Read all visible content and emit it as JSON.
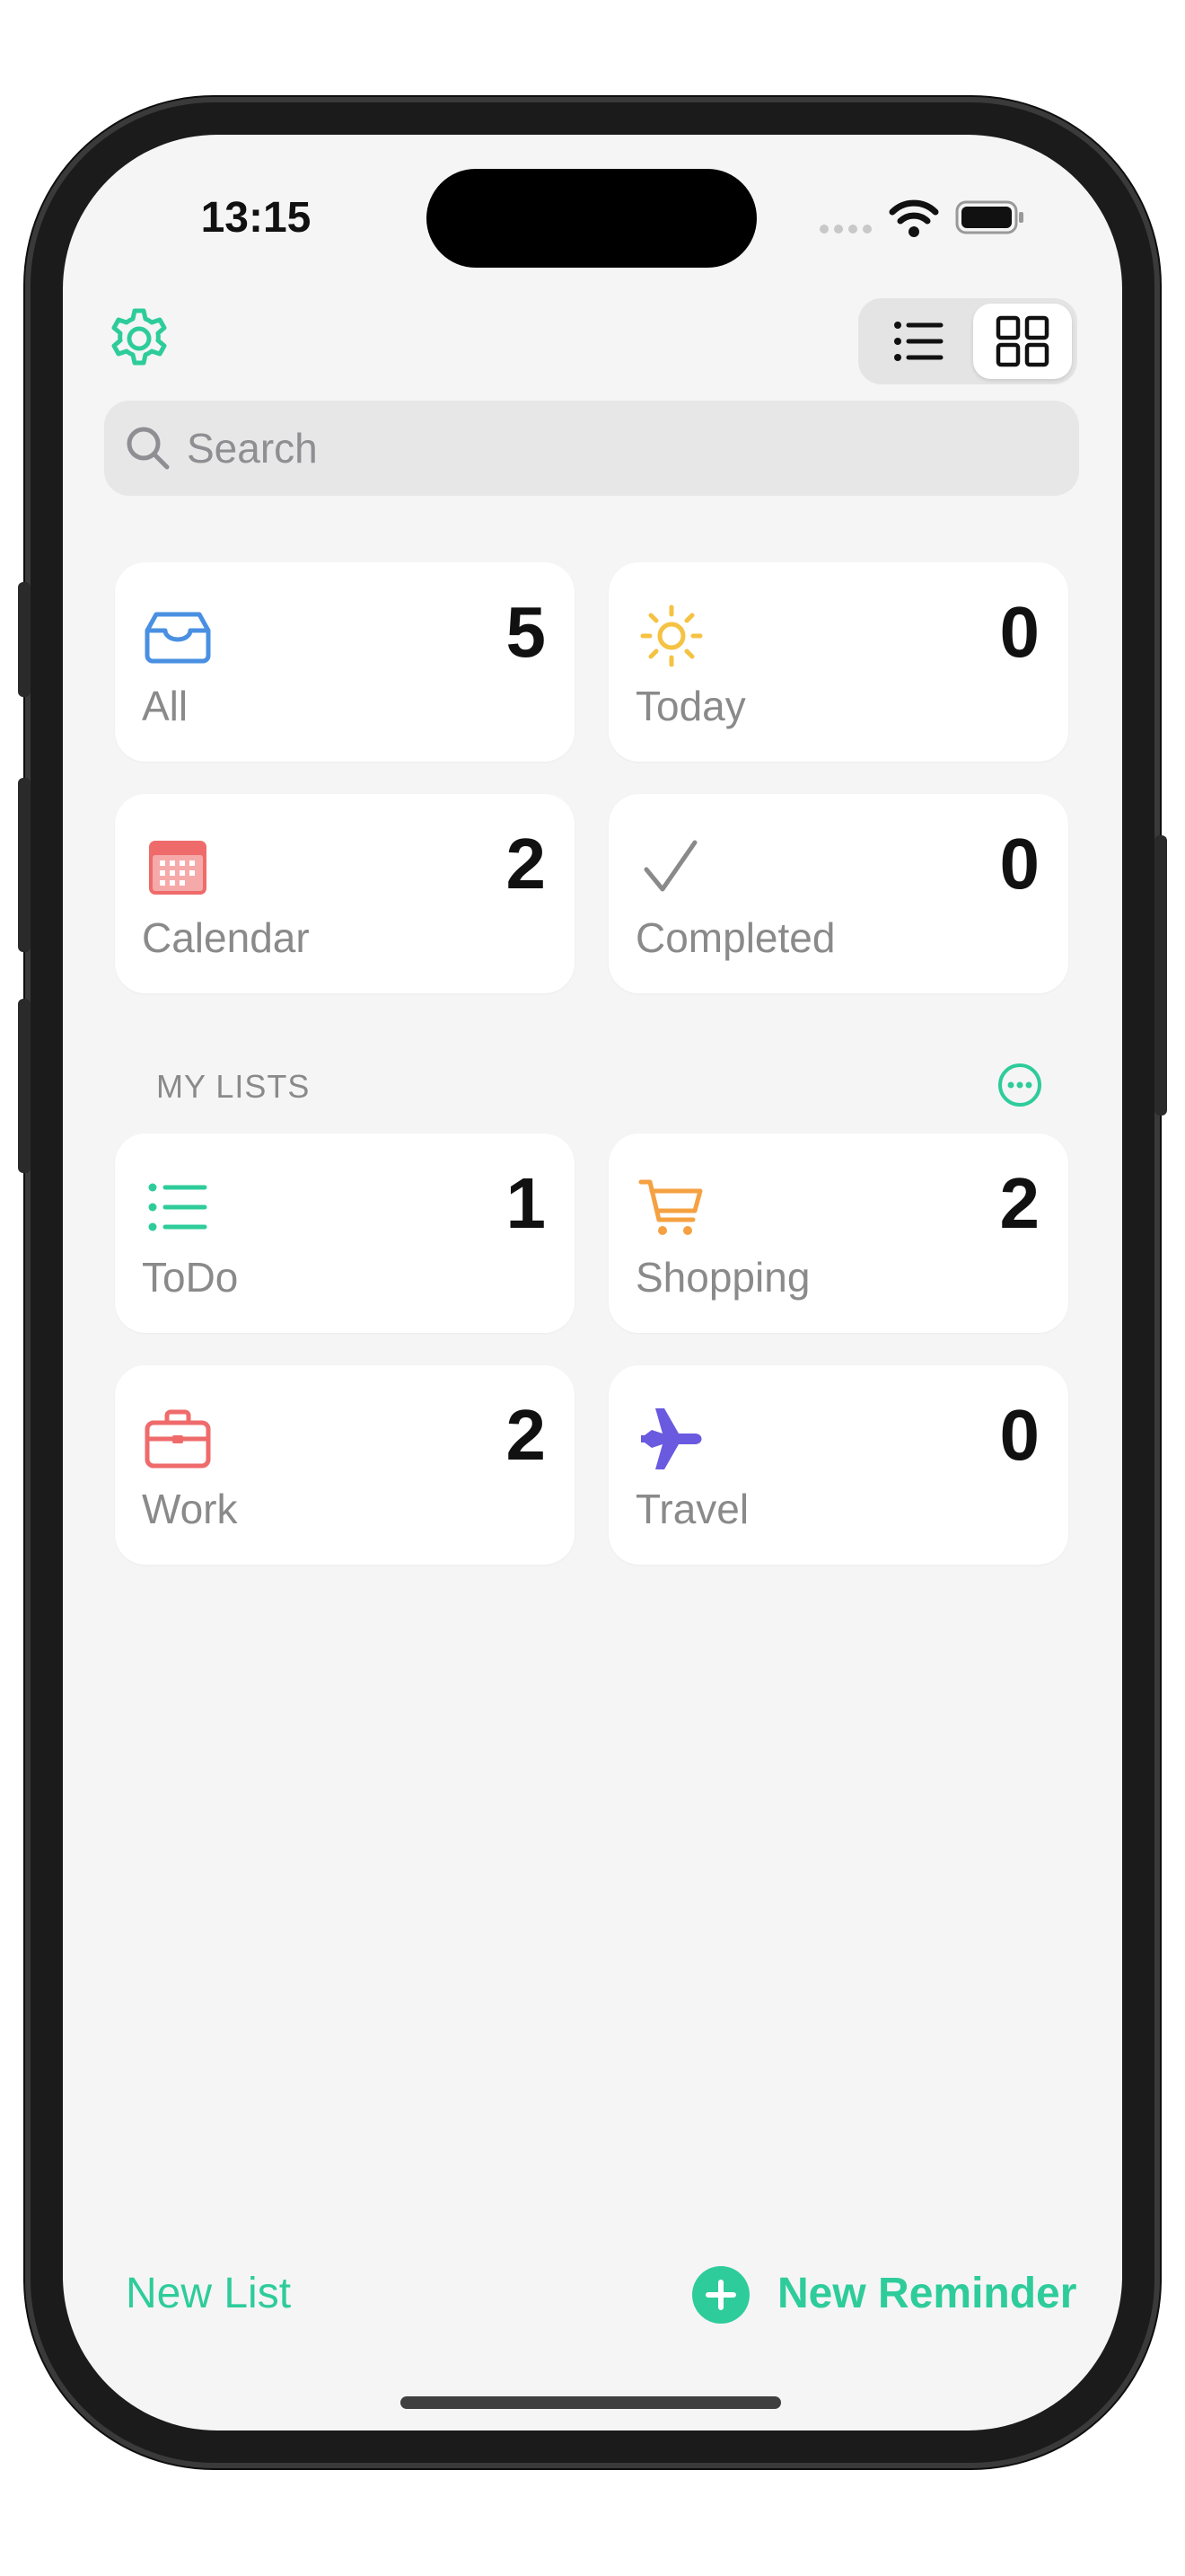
{
  "status_bar": {
    "time": "13:15"
  },
  "header": {
    "settings_icon": "gear-icon",
    "view_toggle": [
      "list-view-icon",
      "grid-view-icon"
    ],
    "active_view": "grid"
  },
  "search": {
    "placeholder": "Search"
  },
  "smart_lists": [
    {
      "label": "All",
      "count": "5",
      "icon": "tray-icon",
      "color": "#4a90e2"
    },
    {
      "label": "Today",
      "count": "0",
      "icon": "sun-icon",
      "color": "#f5c242"
    },
    {
      "label": "Calendar",
      "count": "2",
      "icon": "calendar-icon",
      "color": "#ef6b6b"
    },
    {
      "label": "Completed",
      "count": "0",
      "icon": "checkmark-icon",
      "color": "#8a8a8a"
    }
  ],
  "my_lists": {
    "title": "MY LISTS",
    "more_icon": "ellipsis-circle-icon",
    "items": [
      {
        "label": "ToDo",
        "count": "1",
        "icon": "list-icon",
        "color": "#2ecc9a"
      },
      {
        "label": "Shopping",
        "count": "2",
        "icon": "cart-icon",
        "color": "#f5a142"
      },
      {
        "label": "Work",
        "count": "2",
        "icon": "briefcase-icon",
        "color": "#ef6b6b"
      },
      {
        "label": "Travel",
        "count": "0",
        "icon": "airplane-icon",
        "color": "#6a5ae0"
      }
    ]
  },
  "footer": {
    "new_list": "New List",
    "new_reminder": "New Reminder",
    "accent": "#2ecc9a"
  }
}
